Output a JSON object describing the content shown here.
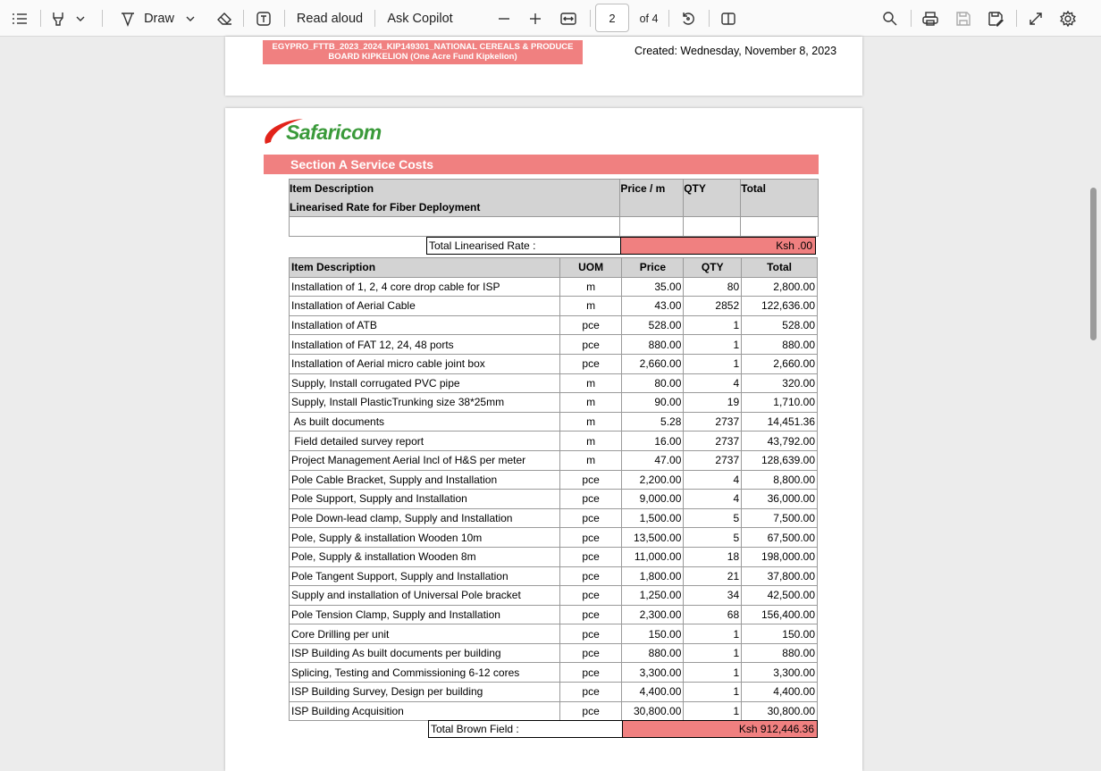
{
  "toolbar": {
    "draw_label": "Draw",
    "read_aloud_label": "Read aloud",
    "ask_copilot_label": "Ask Copilot",
    "page_current": "2",
    "page_total": "of 4"
  },
  "page1": {
    "banner_line1": "EGYPRO_FTTB_2023_2024_KIP149301_NATIONAL CEREALS & PRODUCE",
    "banner_line2": "BOARD KIPKELION (One Acre Fund Kipkelion)",
    "created": "Created: Wednesday, November 8, 2023"
  },
  "page2": {
    "logo": "Safaricom",
    "section_title": "Section A Service Costs",
    "t1_headers": [
      "Item Description",
      "Price / m",
      "QTY",
      "Total"
    ],
    "t1_subheader": "Linearised Rate for Fiber Deployment",
    "t1_total_label": "Total Linearised Rate :",
    "t1_total_value": "Ksh .00",
    "t2_headers": [
      "Item Description",
      "UOM",
      "Price",
      "QTY",
      "Total"
    ],
    "rows": [
      [
        "Installation of 1, 2, 4 core drop cable for ISP",
        "m",
        "35.00",
        "80",
        "2,800.00"
      ],
      [
        "Installation of Aerial Cable",
        "m",
        "43.00",
        "2852",
        "122,636.00"
      ],
      [
        "Installation of ATB",
        "pce",
        "528.00",
        "1",
        "528.00"
      ],
      [
        "Installation of FAT 12, 24, 48 ports",
        "pce",
        "880.00",
        "1",
        "880.00"
      ],
      [
        "Installation of Aerial micro cable joint box",
        "pce",
        "2,660.00",
        "1",
        "2,660.00"
      ],
      [
        "Supply, Install corrugated PVC pipe",
        "m",
        "80.00",
        "4",
        "320.00"
      ],
      [
        "Supply, Install PlasticTrunking size 38*25mm",
        "m",
        "90.00",
        "19",
        "1,710.00"
      ],
      [
        " As built documents",
        "m",
        "5.28",
        "2737",
        "14,451.36"
      ],
      [
        " Field detailed survey report",
        "m",
        "16.00",
        "2737",
        "43,792.00"
      ],
      [
        "Project Management Aerial Incl of H&S per meter",
        "m",
        "47.00",
        "2737",
        "128,639.00"
      ],
      [
        "Pole Cable Bracket, Supply and Installation",
        "pce",
        "2,200.00",
        "4",
        "8,800.00"
      ],
      [
        "Pole Support, Supply and Installation",
        "pce",
        "9,000.00",
        "4",
        "36,000.00"
      ],
      [
        "Pole Down-lead clamp, Supply and Installation",
        "pce",
        "1,500.00",
        "5",
        "7,500.00"
      ],
      [
        "Pole, Supply & installation Wooden 10m",
        "pce",
        "13,500.00",
        "5",
        "67,500.00"
      ],
      [
        "Pole, Supply & installation Wooden 8m",
        "pce",
        "11,000.00",
        "18",
        "198,000.00"
      ],
      [
        "Pole Tangent Support, Supply and Installation",
        "pce",
        "1,800.00",
        "21",
        "37,800.00"
      ],
      [
        "Supply and installation of Universal Pole bracket",
        "pce",
        "1,250.00",
        "34",
        "42,500.00"
      ],
      [
        "Pole Tension Clamp, Supply and Installation",
        "pce",
        "2,300.00",
        "68",
        "156,400.00"
      ],
      [
        "Core Drilling per unit",
        "pce",
        "150.00",
        "1",
        "150.00"
      ],
      [
        "ISP Building As built documents per building",
        "pce",
        "880.00",
        "1",
        "880.00"
      ],
      [
        "Splicing, Testing and Commissioning 6-12 cores",
        "pce",
        "3,300.00",
        "1",
        "3,300.00"
      ],
      [
        "ISP Building Survey, Design per building",
        "pce",
        "4,400.00",
        "1",
        "4,400.00"
      ],
      [
        "ISP Building Acquisition",
        "pce",
        "30,800.00",
        "1",
        "30,800.00"
      ]
    ],
    "brown_label": "Total Brown Field :",
    "brown_value": "Ksh 912,446.36"
  },
  "colors": {
    "banner": "#f08080",
    "header_gray": "#d3d3d3",
    "safaricom_green": "#3a9a3a",
    "safaricom_red": "#e2231a"
  }
}
